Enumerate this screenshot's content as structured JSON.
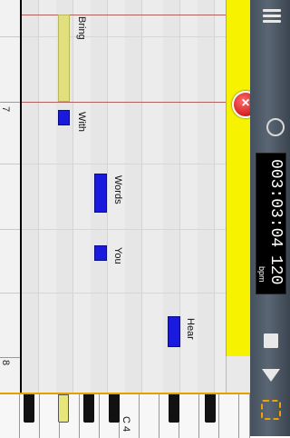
{
  "roll": {
    "measures": [
      {
        "label": "7"
      },
      {
        "label": "8"
      }
    ],
    "lyrics": {
      "bring": "Bring",
      "with": "With",
      "words": "Words",
      "you": "You",
      "hear": "Hear"
    },
    "keyboard_label": "C 4"
  },
  "transport": {
    "position": "003:03:04",
    "tempo": "120",
    "tempo_unit": "bpm"
  },
  "colors": {
    "accent": "#f7f300",
    "note": "#1a1adf",
    "selected_note": "#e2e07c",
    "delete": "#c00000"
  },
  "icons": [
    "menu-icon",
    "user-icon",
    "delete-icon",
    "stop-icon",
    "play-icon",
    "loop-icon"
  ]
}
